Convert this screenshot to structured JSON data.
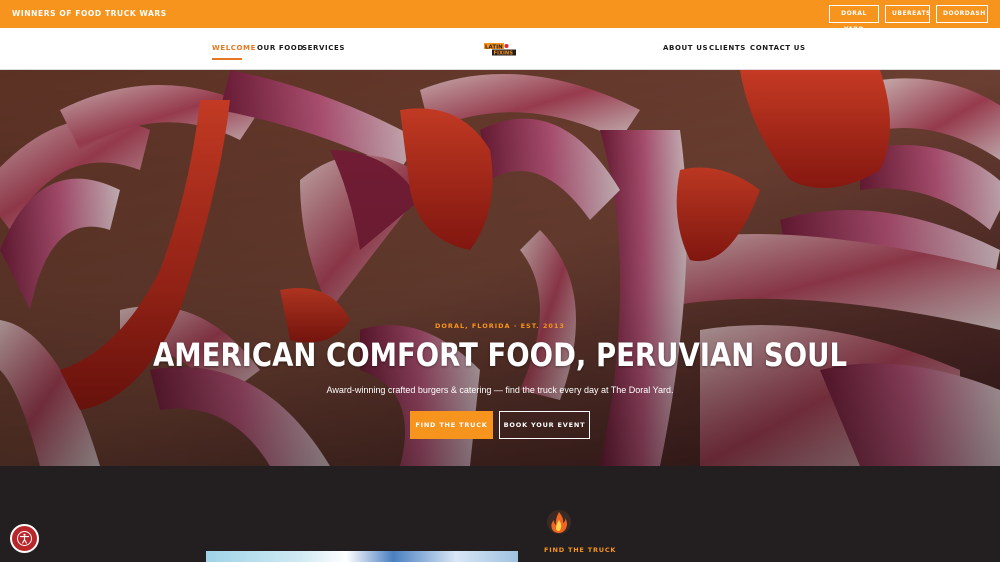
{
  "topbar": {
    "award_text": "WINNERS OF FOOD TRUCK WARS",
    "links": [
      "DORAL YARD",
      "UBEREATS",
      "DOORDASH"
    ]
  },
  "nav": {
    "left_items": [
      "WELCOME",
      "OUR FOOD",
      "SERVICES"
    ],
    "right_items": [
      "ABOUT US",
      "CLIENTS",
      "CONTACT US"
    ],
    "active": "WELCOME",
    "logo_text": [
      "LATIN",
      "FIXINS"
    ]
  },
  "hero": {
    "kicker": "DORAL, FLORIDA · EST. 2013",
    "title": "AMERICAN COMFORT FOOD, PERUVIAN SOUL",
    "subtitle": "Award-winning crafted burgers & catering — find the truck every day at The Doral Yard.",
    "primary_button": "FIND THE TRUCK",
    "secondary_button": "BOOK YOUR EVENT"
  },
  "section": {
    "find_label": "FIND THE TRUCK"
  },
  "icons": {
    "flame": "flame-icon",
    "accessibility": "accessibility-icon"
  },
  "colors": {
    "accent": "#f7941d",
    "dark_bg": "#231f20",
    "accessibility_red": "#b8282a"
  }
}
